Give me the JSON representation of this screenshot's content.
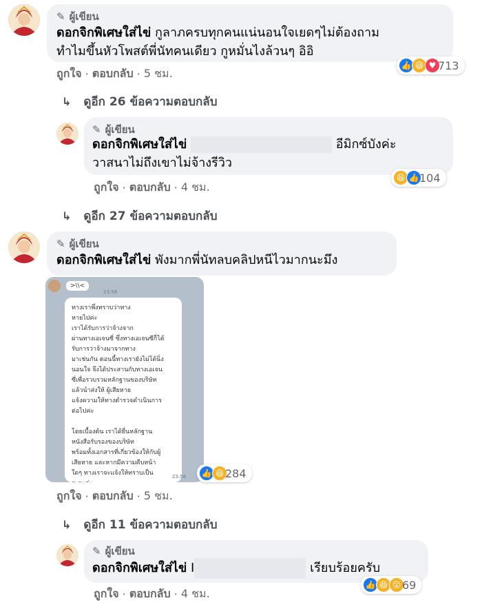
{
  "author_badge": "ผู้เขียน",
  "page_name": "ดอกจิกพิเศษใส่ไข่",
  "comments": [
    {
      "text_line1": "กูลาภครบทุกคนแน่นอนใจเยดๆไม่ต้องถาม",
      "text_line2": "ทำไมขึ้นหัวโพสต์พี่นัทคนเดียว กูหมั่นไงล้วนๆ อิอิ",
      "like": "ถูกใจ",
      "reply": "ตอบกลับ",
      "time": "5 ชม.",
      "reaction_count": "713",
      "reactions": [
        "like-icon",
        "haha-icon",
        "love-icon"
      ],
      "more_replies": "ดูอีก 26 ข้อความตอบกลับ"
    },
    {
      "text_line1_suffix": "อีมิกซ์บังค่ะ",
      "text_line2": "วาสนาไม่ถึงเขาไม่จ้างรีวิว",
      "like": "ถูกใจ",
      "reply": "ตอบกลับ",
      "time": "4 ชม.",
      "reaction_count": "104",
      "reactions": [
        "haha-icon",
        "like-icon"
      ],
      "more_replies": "ดูอีก 27 ข้อความตอบกลับ"
    },
    {
      "text": "พังมากพี่นัทลบคลิปหนีไวมากนะมึง",
      "image": {
        "chat_header": ">\\\\<",
        "time_top": "23:58",
        "time_bottom": "23:58",
        "lines": [
          "ทางเราพึ่งทราบว่าทาง",
          "หายไปค่ะ",
          "เราได้รับการว่าจ้างจาก",
          "ผ่านทางเอเจนซี่ ซึ่งทางเอเจนซีก็ได้",
          "รับการว่าจ้างมาจากทาง",
          "มาเช่นกัน ตอนนี้ทางเรายังไม่ได้นิ่ง",
          "นอนใจ จึงได้ประสานกับทางเอเจน",
          "ซี่เพื่อรวบรวมหลักฐานของบริษัท",
          "แล้วนำส่งให้ ผู้เสียหาย",
          "แจ้งความให้ทางตำรวจดำเนินการ",
          "ต่อไปค่ะ",
          "",
          "โดยเบื้องต้น เราได้ยื่นหลักฐาน",
          "หนังสือรับรองของบริษัท",
          "พร้อมทั้งเอกสารที่เกี่ยวข้องให้กับผู้",
          "เสียหาย และหากมีความคืบหน้า",
          "ใดๆ ทางเราจะแจ้งให้ทราบเป็น",
          "ระยะค่ะ"
        ]
      },
      "like": "ถูกใจ",
      "reply": "ตอบกลับ",
      "time": "5 ชม.",
      "reaction_count": "284",
      "reactions": [
        "like-icon",
        "haha-icon"
      ],
      "more_replies": "ดูอีก 11 ข้อความตอบกลับ"
    },
    {
      "text_prefix": "I",
      "text_suffix": "เรียบร้อยครับ",
      "like": "ถูกใจ",
      "reply": "ตอบกลับ",
      "time": "4 ชม.",
      "reaction_count": "69",
      "reactions": [
        "like-icon",
        "haha-icon",
        "wow-icon"
      ]
    }
  ]
}
